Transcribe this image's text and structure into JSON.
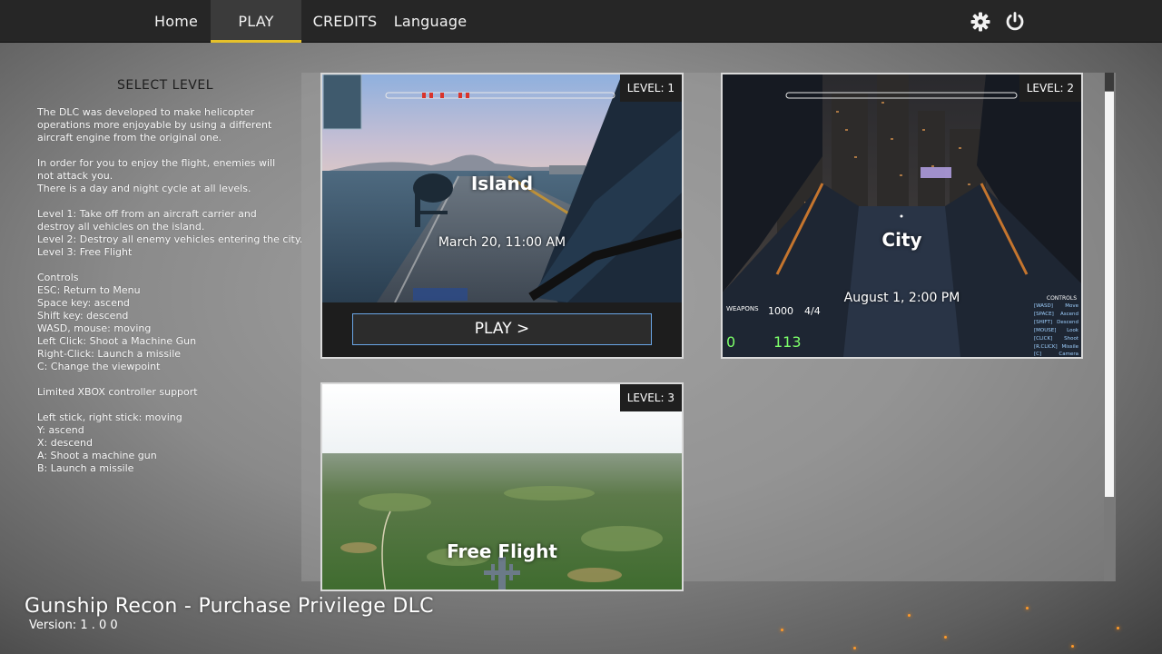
{
  "nav": {
    "home": "Home",
    "play": "PLAY",
    "credits": "CREDITS",
    "language": "Language"
  },
  "icons": {
    "settings": "gear-icon",
    "quit": "power-icon"
  },
  "colors": {
    "accent": "#e6c12a",
    "button_border": "#6aa6e6"
  },
  "side": {
    "title": "SELECT LEVEL",
    "text": "The DLC was developed to make helicopter\noperations more enjoyable by using a different\naircraft engine from the original one.\n\nIn order for you to enjoy the flight, enemies will\nnot attack you.\nThere is a day and night cycle at all levels.\n\nLevel 1: Take off from an aircraft carrier and\ndestroy all vehicles on the island.\nLevel 2: Destroy all enemy vehicles entering the city.\nLevel 3: Free Flight\n\nControls\nESC: Return to Menu\nSpace key: ascend\nShift key: descend\nWASD, mouse: moving\nLeft Click: Shoot a Machine Gun\nRight-Click: Launch a missile\nC: Change the viewpoint\n\nLimited XBOX controller support\n\nLeft stick, right stick: moving\nY: ascend\nX: descend\nA: Shoot a machine gun\nB: Launch a missile"
  },
  "levels": [
    {
      "badge": "LEVEL: 1",
      "name": "Island",
      "time": "March 20, 11:00 AM",
      "play": "PLAY >"
    },
    {
      "badge": "LEVEL: 2",
      "name": "City",
      "time": "August 1, 2:00 PM"
    },
    {
      "badge": "LEVEL: 3",
      "name": "Free Flight"
    }
  ],
  "hud": {
    "weapons": "WEAPONS",
    "ammo": "1000",
    "missiles": "4/4",
    "speed": "0",
    "altitude": "113",
    "controls_title": "CONTROLS",
    "controls_keys": [
      "[WASD]",
      "[SPACE]",
      "[SHIFT]",
      "[MOUSE]",
      "[CLICK]",
      "[R.CLICK]",
      "[C]"
    ],
    "controls_actions": [
      "Move",
      "Ascend",
      "Descend",
      "Look",
      "Shoot",
      "Missile",
      "Camera"
    ]
  },
  "footer": {
    "title": "Gunship Recon - Purchase Privilege DLC",
    "version": "Version: 1 . 0 0"
  }
}
